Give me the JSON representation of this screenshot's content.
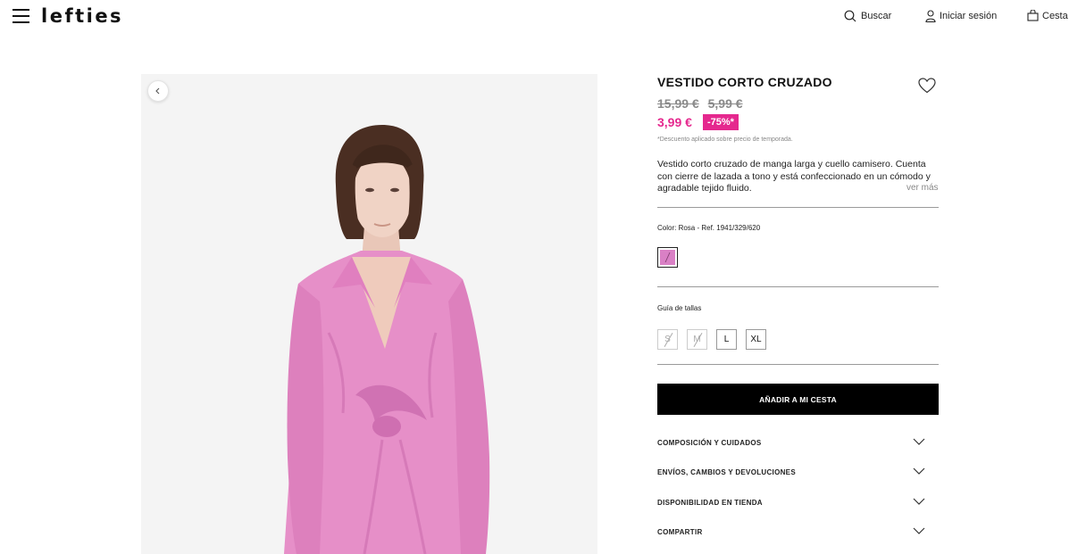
{
  "header": {
    "logo": "lefties",
    "search_label": "Buscar",
    "login_label": "Iniciar sesión",
    "cart_label": "Cesta"
  },
  "product": {
    "title": "VESTIDO CORTO CRUZADO",
    "old_price_1": "15,99 €",
    "old_price_2": "5,99 €",
    "current_price": "3,99 €",
    "discount": "-75%*",
    "disclaimer": "*Descuento aplicado sobre precio de temporada.",
    "description": "Vestido corto cruzado de manga larga y cuello camisero. Cuenta con cierre de lazada a tono y está confeccionado en un cómodo y agradable tejido fluido.",
    "ver_mas": "ver más",
    "color_label": "Color: Rosa - Ref. 1941/329/620",
    "swatch_color": "#d980c5",
    "size_guide": "Guía de tallas",
    "sizes": [
      {
        "label": "S",
        "available": false
      },
      {
        "label": "M",
        "available": false
      },
      {
        "label": "L",
        "available": true
      },
      {
        "label": "XL",
        "available": true
      }
    ],
    "add_to_cart": "AÑADIR A MI CESTA",
    "accordion": [
      "COMPOSICIÓN Y CUIDADOS",
      "ENVÍOS, CAMBIOS Y DEVOLUCIONES",
      "DISPONIBILIDAD EN TIENDA",
      "COMPARTIR"
    ]
  },
  "colors": {
    "accent_pink": "#e5288e",
    "dress_pink": "#e68fc8"
  }
}
